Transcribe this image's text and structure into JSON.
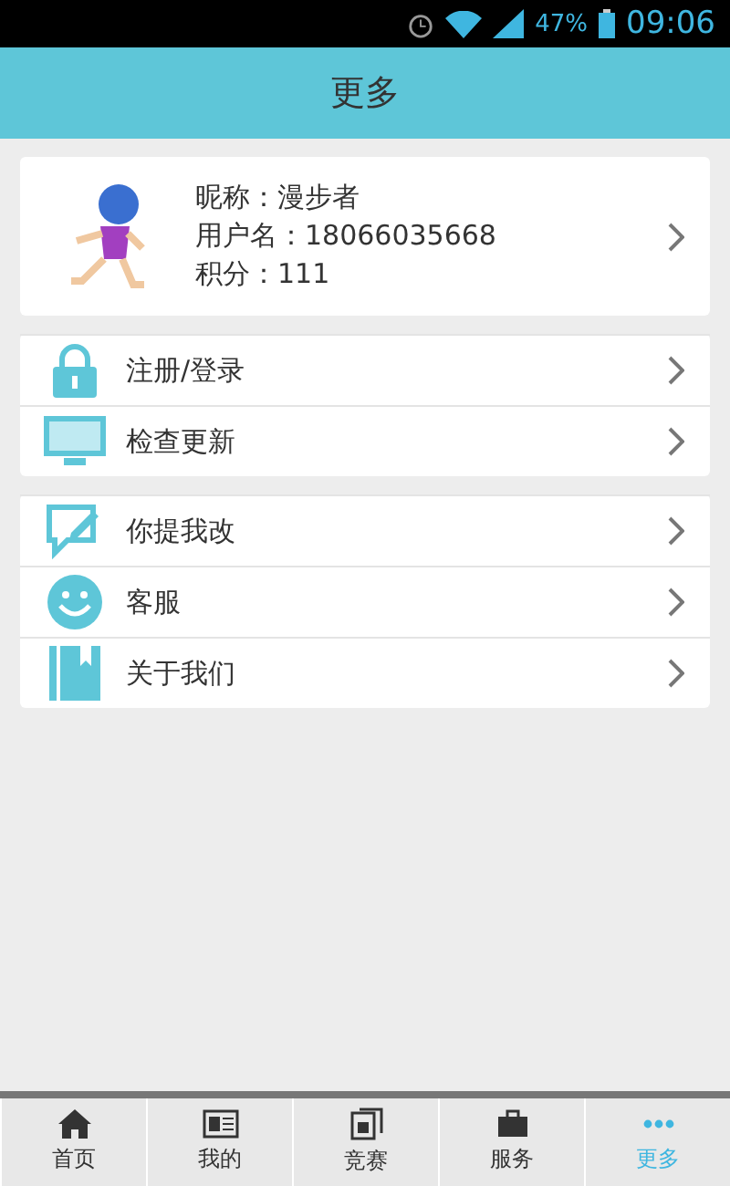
{
  "status_bar": {
    "battery": "47%",
    "time": "09:06"
  },
  "header": {
    "title": "更多"
  },
  "profile": {
    "nickname": "昵称：漫步者",
    "username": "用户名：18066035668",
    "points": "积分：111"
  },
  "menu_groups": [
    {
      "items": [
        {
          "label": "注册/登录"
        },
        {
          "label": "检查更新"
        }
      ]
    },
    {
      "items": [
        {
          "label": "你提我改"
        },
        {
          "label": "客服"
        },
        {
          "label": "关于我们"
        }
      ]
    }
  ],
  "tabs": [
    {
      "label": "首页",
      "selected": false
    },
    {
      "label": "我的",
      "selected": false
    },
    {
      "label": "竞赛",
      "selected": false
    },
    {
      "label": "服务",
      "selected": false
    },
    {
      "label": "更多",
      "selected": true
    }
  ]
}
